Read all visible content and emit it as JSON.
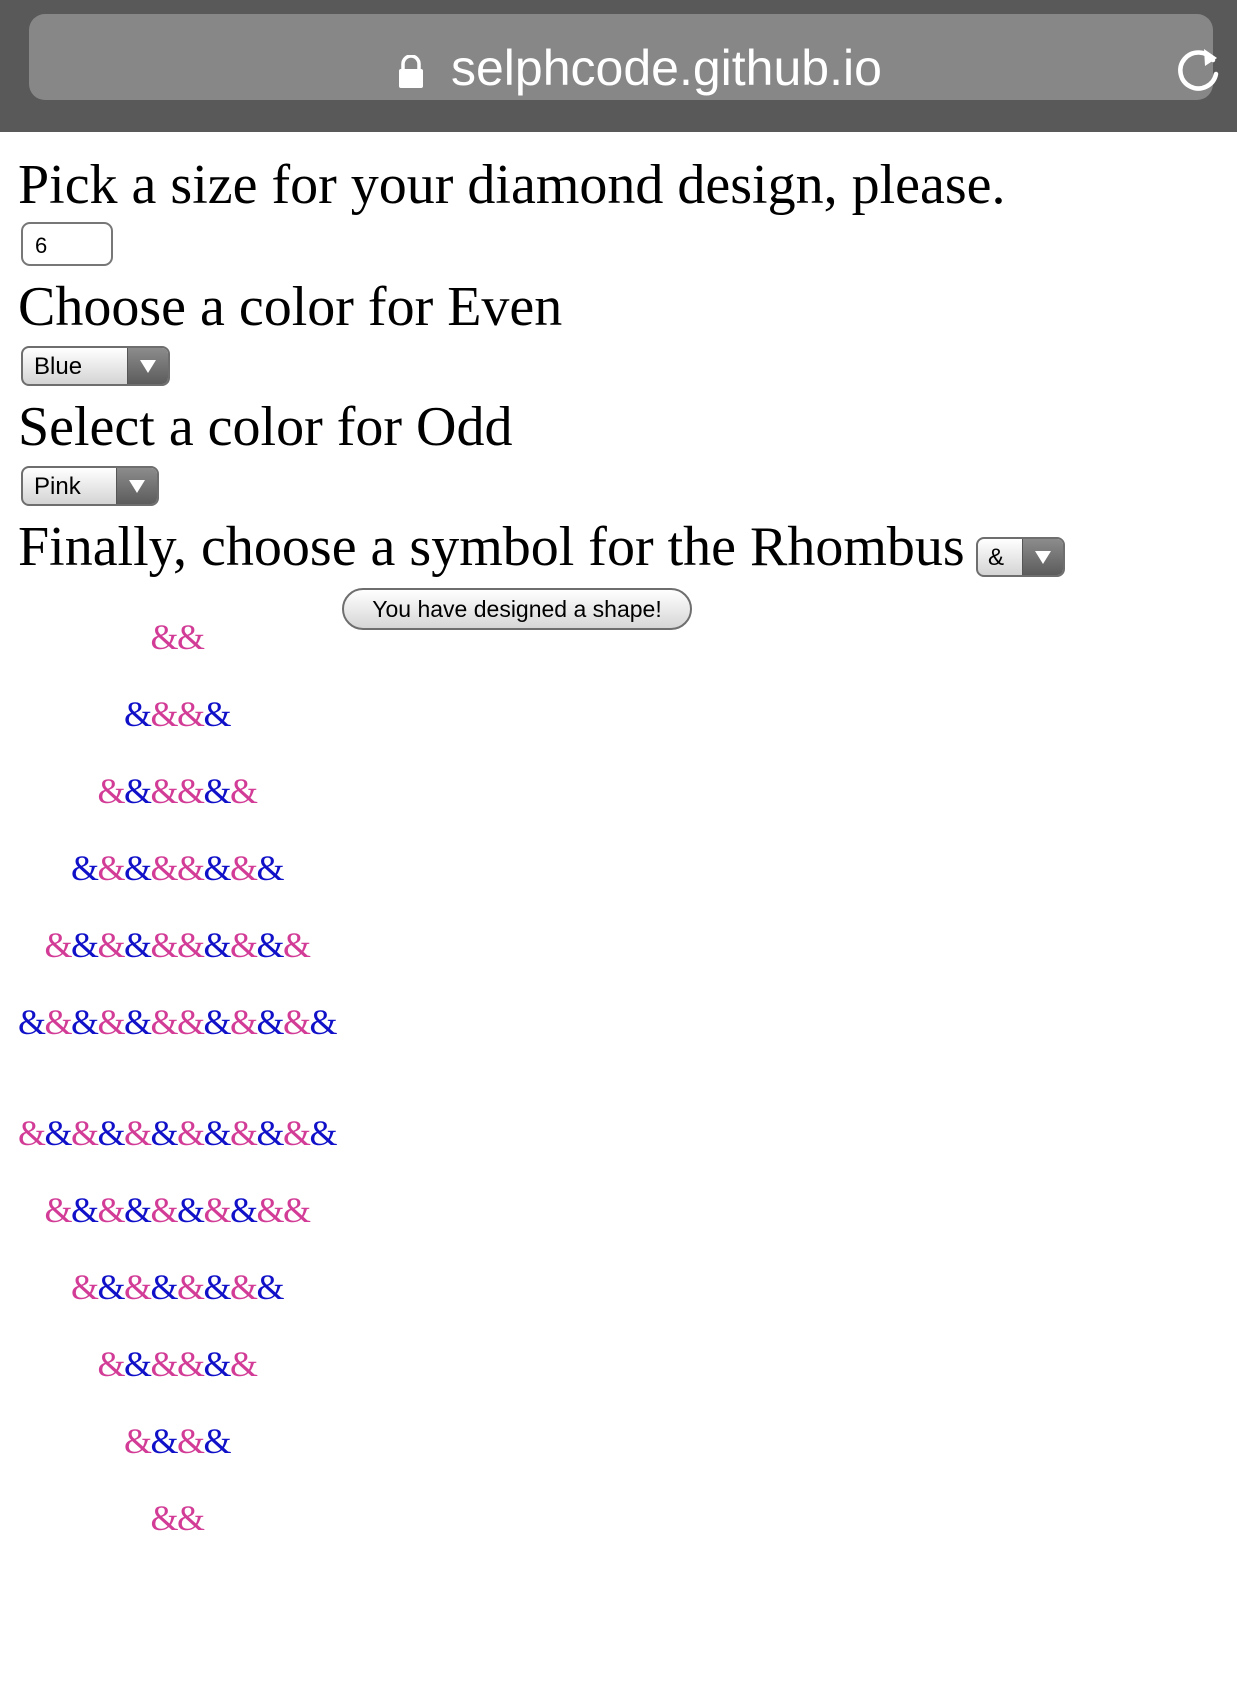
{
  "browser": {
    "url": "selphcode.github.io",
    "icons": {
      "lock": "lock-icon",
      "reload": "reload-icon"
    }
  },
  "form": {
    "size_prompt": "Pick a size for your diamond design, please.",
    "size_value": "6",
    "even_prompt": "Choose a color for Even",
    "even_value": "Blue",
    "odd_prompt": "Select a color for Odd",
    "odd_value": "Pink",
    "symbol_prompt": "Finally, choose a symbol for the Rhombus",
    "symbol_value": "&",
    "button_label": "You have designed a shape!"
  },
  "colors": {
    "pink": "#d23c96",
    "blue": "#1010c8"
  },
  "diamond": {
    "symbol": "&",
    "rows": [
      "PP",
      "BPPB",
      "PBPPBP",
      "BPBPPBPB",
      "PBPBPPBPBP",
      "BPBPBPPBPBPB",
      "PBPBPBPBPBPB",
      "PBPBPBPBPP",
      "PBPBPBPB",
      "PBPPBP",
      "PBPB",
      "PP"
    ]
  }
}
